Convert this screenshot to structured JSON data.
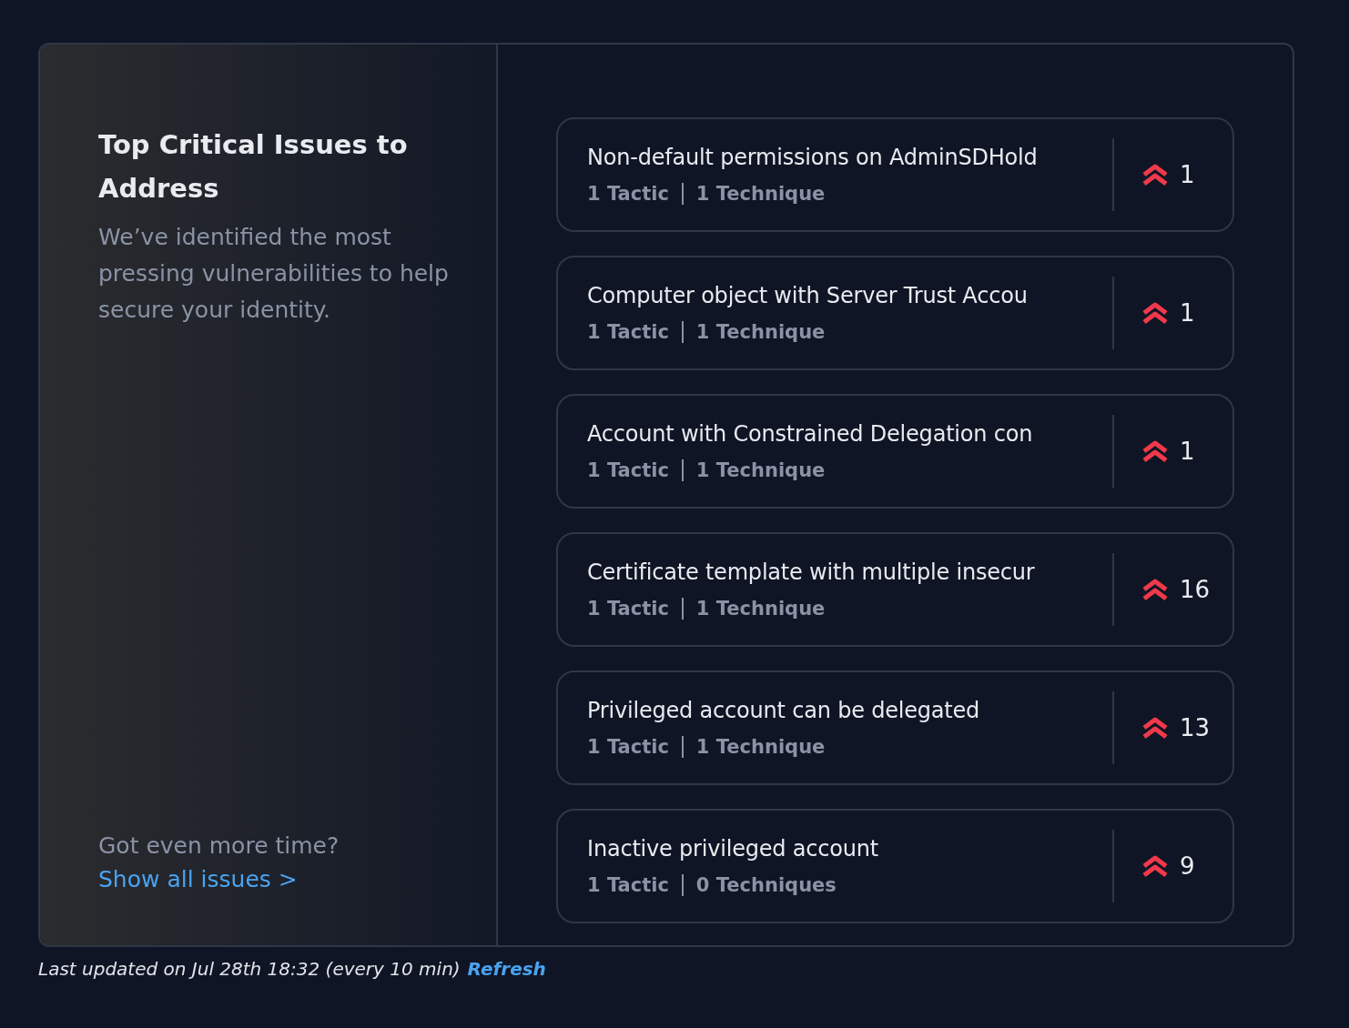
{
  "intro": {
    "title": "Top Critical Issues to Address",
    "description": "We’ve identified the most pressing vulnerabilities to help secure your identity.",
    "prompt": "Got even more time?",
    "link": "Show all issues >"
  },
  "issues": [
    {
      "title": "Non-default permissions on AdminSDHold",
      "tactics": "1 Tactic",
      "techniques": "1 Technique",
      "count": "1"
    },
    {
      "title": "Computer object with Server Trust Accou",
      "tactics": "1 Tactic",
      "techniques": "1 Technique",
      "count": "1"
    },
    {
      "title": "Account with Constrained Delegation con",
      "tactics": "1 Tactic",
      "techniques": "1 Technique",
      "count": "1"
    },
    {
      "title": "Certificate template with multiple insecur",
      "tactics": "1 Tactic",
      "techniques": "1 Technique",
      "count": "16"
    },
    {
      "title": "Privileged account can be delegated",
      "tactics": "1 Tactic",
      "techniques": "1 Technique",
      "count": "13"
    },
    {
      "title": "Inactive privileged account",
      "tactics": "1 Tactic",
      "techniques": "0 Techniques",
      "count": "9"
    }
  ],
  "footer": {
    "text": "Last updated on Jul 28th 18:32 (every 10 min)",
    "link": "Refresh"
  }
}
